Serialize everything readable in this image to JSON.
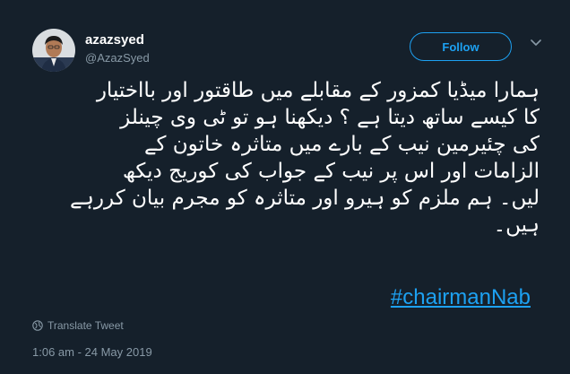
{
  "author": {
    "name": "azazsyed",
    "handle": "@AzazSyed"
  },
  "follow_label": "Follow",
  "tweet": {
    "lines": [
      "ہمارا میڈیا کمزور کے مقابلے میں طاقتور اور بااختیار",
      "کا کیسے ساتھ دیتا ہے ؟ دیکھنا ہو تو ٹی وی چینلز",
      "کی چئیرمین نیب کے بارے میں متاثرہ خاتون کے",
      "الزامات اور اس پر نیب کے جواب کی کوریج دیکھ",
      "لیں۔ ہم ملزم کو ہیرو اور متاثرہ کو مجرم بیان کررہے",
      "ہیں۔"
    ],
    "hashtag": "#chairmanNab"
  },
  "translate_label": "Translate Tweet",
  "timestamp": "1:06 am - 24 May 2019",
  "colors": {
    "background": "#15202b",
    "accent": "#1da1f2",
    "secondary_text": "#8899a6"
  },
  "icons": [
    "avatar",
    "chevron-down-icon",
    "globe-icon"
  ]
}
